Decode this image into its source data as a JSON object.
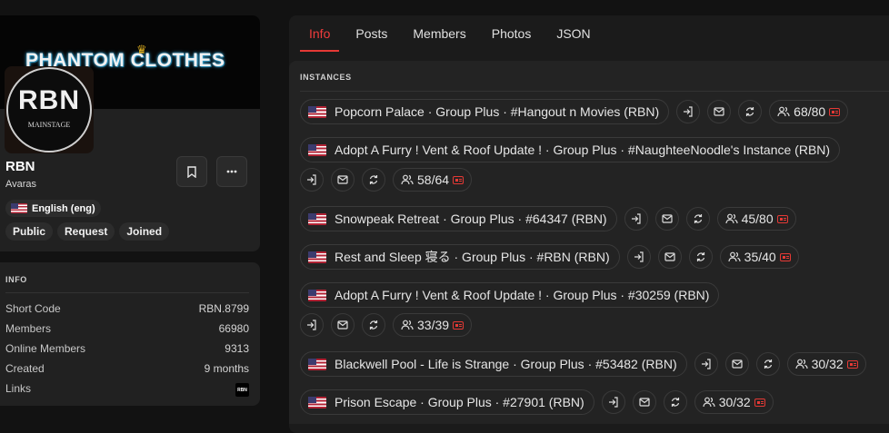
{
  "profile": {
    "banner_text": "PHANTOM CLOTHES",
    "avatar_text": "RBN",
    "avatar_subtext": "MAINSTAGE",
    "name": "RBN",
    "owner": "Avaras",
    "language": "English (eng)",
    "tags": [
      "Public",
      "Request",
      "Joined"
    ],
    "bookmark_icon": "bookmark-icon",
    "more_icon": "more-icon"
  },
  "info": {
    "title": "INFO",
    "rows": [
      {
        "label": "Short Code",
        "value": "RBN.8799"
      },
      {
        "label": "Members",
        "value": "66980"
      },
      {
        "label": "Online Members",
        "value": "9313"
      },
      {
        "label": "Created",
        "value": "9 months"
      },
      {
        "label": "Links",
        "value": "RBN"
      }
    ]
  },
  "tabs": [
    "Info",
    "Posts",
    "Members",
    "Photos",
    "JSON"
  ],
  "active_tab": "Info",
  "instances": {
    "title": "INSTANCES",
    "items": [
      {
        "name": "Popcorn Palace · Group Plus  · #Hangout n Movies (RBN)",
        "count": "68/80"
      },
      {
        "name": "Adopt A Furry ! Vent & Roof Update ! · Group Plus  · #NaughteeNoodle's Instance (RBN)",
        "count": "58/64"
      },
      {
        "name": "Snowpeak Retreat · Group Plus  · #64347 (RBN)",
        "count": "45/80"
      },
      {
        "name": "Rest and Sleep 寝る · Group Plus  · #RBN (RBN)",
        "count": "35/40"
      },
      {
        "name": "Adopt A Furry ! Vent & Roof Update ! · Group Plus  · #30259 (RBN)",
        "count": "33/39"
      },
      {
        "name": "Blackwell Pool - Life is Strange · Group Plus  · #53482 (RBN)",
        "count": "30/32"
      },
      {
        "name": "Prison Escape · Group Plus  · #27901 (RBN)",
        "count": "30/32"
      }
    ]
  },
  "colors": {
    "accent": "#e53935",
    "background": "#121212",
    "card": "#212121"
  }
}
